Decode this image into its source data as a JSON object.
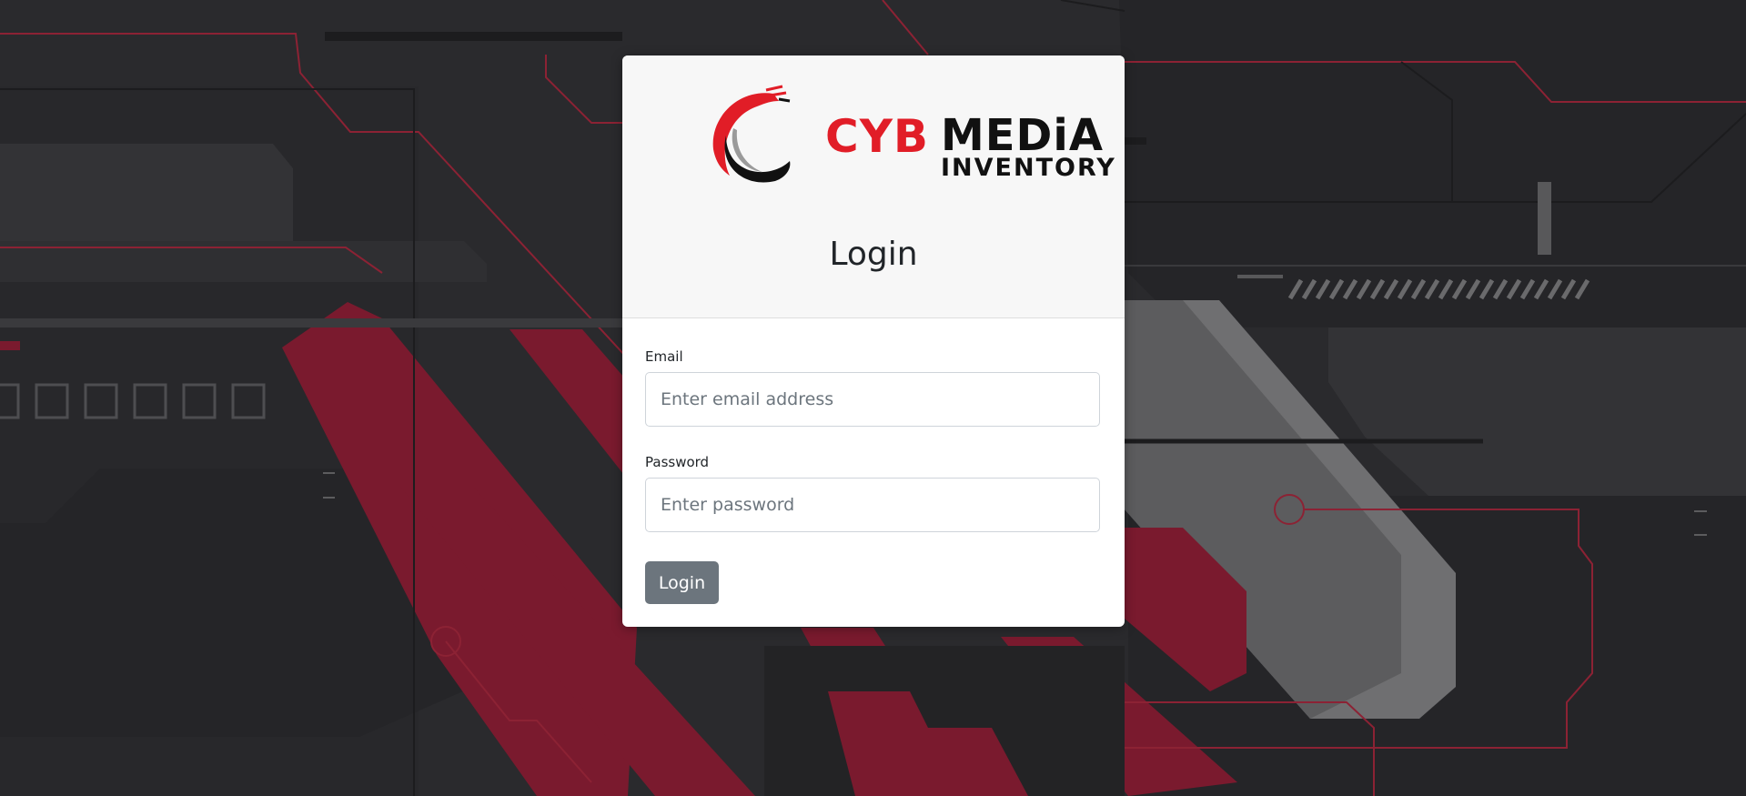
{
  "brand": {
    "cyb": "CYB",
    "media": "MEDiA",
    "inventory": "INVENTORY"
  },
  "login": {
    "title": "Login",
    "email_label": "Email",
    "email_placeholder": "Enter email address",
    "password_label": "Password",
    "password_placeholder": "Enter password",
    "submit_label": "Login"
  },
  "colors": {
    "brand_red": "#e11d27",
    "button_gray": "#6c757d",
    "background_dark": "#2a2a2d",
    "background_crimson": "#7a1a2e"
  }
}
